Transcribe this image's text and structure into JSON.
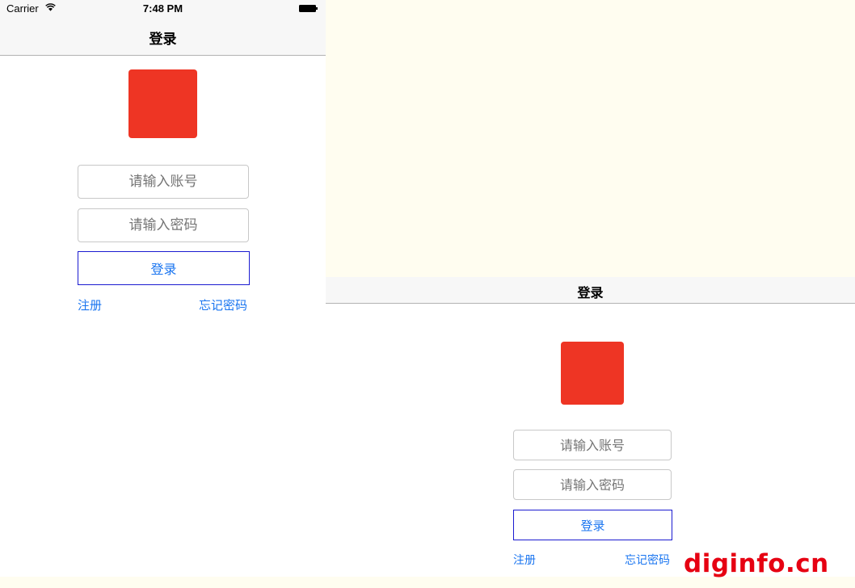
{
  "status_bar": {
    "carrier": "Carrier",
    "time": "7:48 PM",
    "wifi_icon": "wifi-icon",
    "battery_icon": "battery-icon"
  },
  "portrait": {
    "nav_title": "登录",
    "username_placeholder": "请输入账号",
    "password_placeholder": "请输入密码",
    "login_label": "登录",
    "register_label": "注册",
    "forgot_label": "忘记密码"
  },
  "landscape": {
    "nav_title": "登录",
    "username_placeholder": "请输入账号",
    "password_placeholder": "请输入密码",
    "login_label": "登录",
    "register_label": "注册",
    "forgot_label": "忘记密码"
  },
  "watermark": "diginfo.cn",
  "colors": {
    "logo": "#ee3524",
    "link": "#1a75f0",
    "button_border": "#1b1bd1",
    "background": "#fffdf0"
  }
}
